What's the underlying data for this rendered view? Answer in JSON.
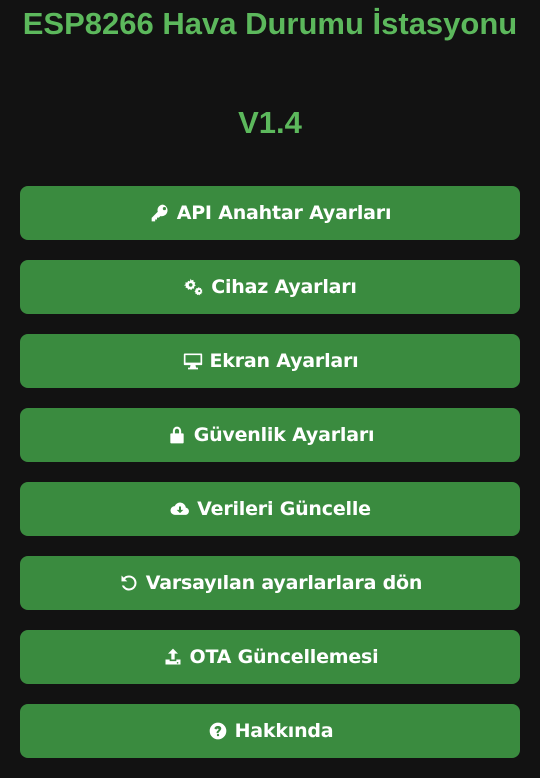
{
  "header": {
    "title": "ESP8266 Hava Durumu İstasyonu",
    "version": "V1.4"
  },
  "colors": {
    "background": "#121212",
    "accent_text": "#5cb85c",
    "button_bg": "#3a8b3f",
    "button_text": "#ffffff"
  },
  "menu": {
    "items": [
      {
        "label": "API Anahtar Ayarları",
        "icon": "key-icon"
      },
      {
        "label": "Cihaz Ayarları",
        "icon": "gears-icon"
      },
      {
        "label": "Ekran Ayarları",
        "icon": "desktop-icon"
      },
      {
        "label": "Güvenlik Ayarları",
        "icon": "lock-icon"
      },
      {
        "label": "Verileri Güncelle",
        "icon": "cloud-download-icon"
      },
      {
        "label": "Varsayılan ayarlarlara dön",
        "icon": "undo-icon"
      },
      {
        "label": "OTA Güncellemesi",
        "icon": "upload-icon"
      },
      {
        "label": "Hakkında",
        "icon": "question-circle-icon"
      }
    ]
  }
}
